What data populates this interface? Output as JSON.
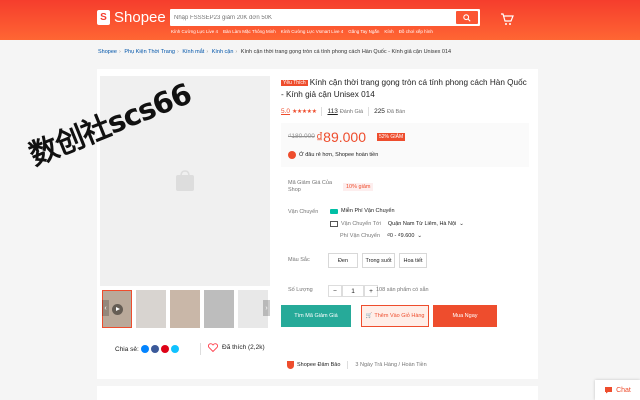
{
  "header": {
    "logo_text": "Shopee",
    "logo_glyph": "S",
    "search_placeholder": "Nhập FSSSEP23 giảm 20K đơn 50K",
    "suggestions": [
      "Kính Cường Lực Live 4",
      "Bàn Làm Mặc Thông Minh",
      "Kính Cường Lực Vsmart Live 4",
      "Găng Tay Ngắn",
      "Kính",
      "Đồ chơi xếp hình"
    ],
    "colors": {
      "brand": "#ee4d2d",
      "teal": "#26aa99"
    }
  },
  "breadcrumb": {
    "items": [
      "Shopee",
      "Phụ Kiện Thời Trang",
      "Kính mắt",
      "Kính cận"
    ],
    "current": "Kính cận thời trang gọng tròn cá tính phong cách Hàn Quốc - Kính giả cận Unisex 014"
  },
  "gallery": {
    "share_label": "Chia sẻ:",
    "favorite_label": "Đã thích (2,2k)",
    "share_icons": [
      "messenger-icon",
      "facebook-icon",
      "pinterest-icon",
      "twitter-icon"
    ]
  },
  "product": {
    "badge": "Yêu Thích",
    "title": "Kính cận thời trang gọng tròn cá tính phong cách Hàn Quốc - Kính giả cận Unisex 014",
    "rating": "5.0",
    "stars": "★★★★★",
    "review_count": "113",
    "review_label": "Đánh Giá",
    "sold_count": "225",
    "sold_label": "Đã Bán",
    "old_price": "₫180.000",
    "price": "₫89.000",
    "discount": "52% GIẢM",
    "price_note": "Ở đâu rẻ hơn, Shopee hoàn tiền"
  },
  "details": {
    "voucher_label": "Mã Giảm Giá Của Shop",
    "voucher_value": "10% giảm",
    "shipping_label": "Vận Chuyển",
    "free_ship": "Miễn Phí Vận Chuyển",
    "ship_to_label": "Vận Chuyển Tới",
    "ship_to_value": "Quận Nam Từ Liêm, Hà Nội",
    "ship_fee_label": "Phí Vận Chuyển",
    "ship_fee_value": "₫0 - ₫9.600",
    "color_label": "Màu Sắc",
    "color_options": [
      "Đen",
      "Trong suốt",
      "Hoa tiết"
    ],
    "qty_label": "Số Lượng",
    "qty_value": "1",
    "stock_text": "108 sản phẩm có sẵn"
  },
  "actions": {
    "find_similar": "Tìm Mã Giảm Giá",
    "add_to_cart": "Thêm Vào Giỏ Hàng",
    "buy_now": "Mua Ngay"
  },
  "guarantee": {
    "brand": "Shopee Đảm Bảo",
    "text": "3 Ngày Trả Hàng / Hoàn Tiền"
  },
  "chat_label": "Chat",
  "watermark_text": "数创社scs66"
}
